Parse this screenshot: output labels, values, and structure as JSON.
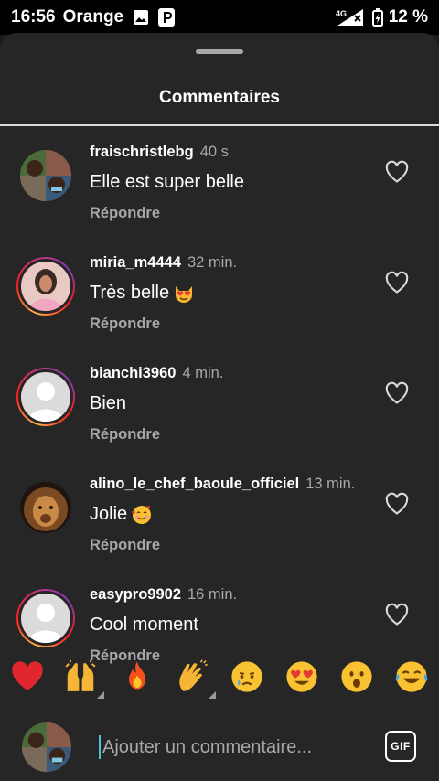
{
  "status_bar": {
    "time": "16:56",
    "carrier": "Orange",
    "network": "4G",
    "battery": "12 %",
    "icons": [
      "image-icon",
      "p-icon",
      "signal-icon",
      "battery-charging-icon"
    ]
  },
  "sheet": {
    "title": "Commentaires"
  },
  "comments": [
    {
      "username": "fraischristlebg",
      "time": "40 s",
      "text": "Elle est super belle",
      "emoji": "",
      "reply": "Répondre",
      "ring": false
    },
    {
      "username": "miria_m4444",
      "time": "32 min.",
      "text": "Très belle",
      "emoji": "heart-eyes-cat",
      "reply": "Répondre",
      "ring": true
    },
    {
      "username": "bianchi3960",
      "time": "4 min.",
      "text": "Bien",
      "emoji": "",
      "reply": "Répondre",
      "ring": true
    },
    {
      "username": "alino_le_chef_baoule_officiel",
      "time": "13 min.",
      "text": "Jolie",
      "emoji": "smiling-face-hearts",
      "reply": "Répondre",
      "ring": false
    },
    {
      "username": "easypro9902",
      "time": "16 min.",
      "text": "Cool moment",
      "emoji": "",
      "reply": "Répondre",
      "ring": true
    }
  ],
  "reactions": [
    "red-heart",
    "raising-hands",
    "fire",
    "clapping-hands",
    "crying-face",
    "heart-eyes-face",
    "astonished-face",
    "tears-of-joy-face"
  ],
  "composer": {
    "placeholder": "Ajouter un commentaire...",
    "gif_label": "GIF"
  },
  "colors": {
    "background": "#262626",
    "secondary_text": "#a8a8a8",
    "cursor": "#4fc3d8"
  }
}
